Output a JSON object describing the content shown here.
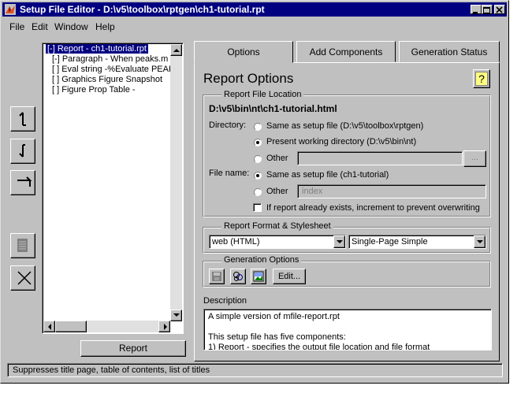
{
  "window": {
    "title": "Setup File Editor - D:\\v5\\toolbox\\rptgen\\ch1-tutorial.rpt"
  },
  "menu": [
    "File",
    "Edit",
    "Window",
    "Help"
  ],
  "tree": {
    "items": [
      "[-] Report - ch1-tutorial.rpt",
      "[-] Paragraph - When peaks.m r",
      "[ ] Eval string -%Evaluate PEAK",
      "[ ] Graphics Figure Snapshot",
      "[ ] Figure Prop Table -"
    ]
  },
  "report_button": "Report",
  "tabs": [
    "Options",
    "Add Components",
    "Generation Status"
  ],
  "active_tab": "Options",
  "heading": "Report Options",
  "help_label": "?",
  "file_location": {
    "title": "Report File Location",
    "path": "D:\\v5\\bin\\nt\\ch1-tutorial.html",
    "directory_label": "Directory:",
    "dir_options": [
      "Same as setup file (D:\\v5\\toolbox\\rptgen)",
      "Present working directory (D:\\v5\\bin\\nt)",
      "Other"
    ],
    "dir_selected": 1,
    "other_dir_value": "",
    "browse_label": "...",
    "filename_label": "File name:",
    "name_options": [
      "Same as setup file (ch1-tutorial)",
      "Other"
    ],
    "name_selected": 0,
    "other_name_value": "index",
    "increment_label": "If report already exists, increment to prevent overwriting",
    "increment_checked": false
  },
  "format": {
    "title": "Report Format & Stylesheet",
    "format_value": "web (HTML)",
    "stylesheet_value": "Single-Page Simple"
  },
  "generation": {
    "title": "Generation Options",
    "edit_label": "Edit..."
  },
  "description": {
    "label": "Description",
    "lines": [
      "A simple version of mfile-report.rpt",
      "",
      "This setup file has five components:",
      "1) Report - specifies the output file location and file format"
    ]
  },
  "status_text": "Suppresses title page, table of contents, list of titles",
  "icons": {
    "app": "matlab-logo-icon",
    "side_buttons": [
      "move-up-icon",
      "move-down-icon",
      "indent-icon",
      "activate-icon",
      "delete-icon"
    ],
    "generation_buttons": [
      "save-icon",
      "graphics-icon",
      "image-icon"
    ]
  },
  "colors": {
    "titlebar": "#000080",
    "face": "#c0c0c0",
    "selection": "#000080"
  }
}
